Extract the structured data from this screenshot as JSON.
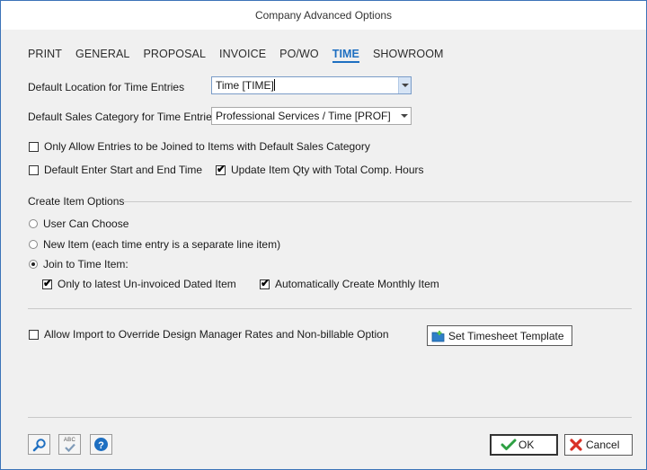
{
  "window": {
    "title": "Company Advanced Options"
  },
  "tabs": [
    {
      "label": "PRINT",
      "active": false
    },
    {
      "label": "GENERAL",
      "active": false
    },
    {
      "label": "PROPOSAL",
      "active": false
    },
    {
      "label": "INVOICE",
      "active": false
    },
    {
      "label": "PO/WO",
      "active": false
    },
    {
      "label": "TIME",
      "active": true
    },
    {
      "label": "SHOWROOM",
      "active": false
    }
  ],
  "fields": {
    "default_location_label": "Default Location for Time Entries",
    "default_location_value": "Time [TIME]",
    "default_sales_label": "Default Sales Category for Time Entries",
    "default_sales_value": "Professional Services / Time [PROF]"
  },
  "checks": {
    "only_allow": {
      "label": "Only Allow Entries to be Joined to Items with Default Sales Category",
      "checked": false
    },
    "default_start_end": {
      "label": "Default Enter Start and End Time",
      "checked": false
    },
    "update_qty": {
      "label": "Update Item Qty with Total Comp. Hours",
      "checked": true
    },
    "only_latest": {
      "label": "Only to latest Un-invoiced Dated Item",
      "checked": true
    },
    "auto_monthly": {
      "label": "Automatically Create Monthly Item",
      "checked": true
    },
    "allow_import": {
      "label": "Allow Import to Override Design Manager Rates and Non-billable Option",
      "checked": false
    }
  },
  "create_item": {
    "section_label": "Create Item Options",
    "options": [
      {
        "label": "User Can Choose",
        "selected": false
      },
      {
        "label": "New Item (each time entry is a separate line item)",
        "selected": false
      },
      {
        "label": "Join to Time Item:",
        "selected": true
      }
    ]
  },
  "buttons": {
    "timesheet": "Set Timesheet Template",
    "ok": "OK",
    "cancel": "Cancel",
    "spell_label": "ABC"
  },
  "colors": {
    "accent": "#1e6fc1",
    "ok_check": "#2ea043",
    "cancel_x": "#d93025",
    "help": "#1e6fc1"
  }
}
